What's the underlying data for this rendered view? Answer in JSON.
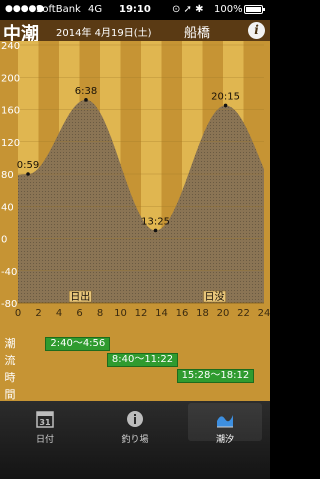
{
  "status_bar": {
    "signal": "●●●●●",
    "carrier": "SoftBank",
    "network": "4G",
    "time": "19:10",
    "icons": "⊙ ➚ ✱",
    "battery": "100%"
  },
  "header": {
    "tide_type": "中潮",
    "date": "2014年 4月19日(土)",
    "place": "船橋",
    "info_label": "i"
  },
  "chart_data": {
    "type": "area",
    "ylim": [
      -80,
      240
    ],
    "y_ticks": [
      "240",
      "200",
      "160",
      "120",
      "80",
      "40",
      "0",
      "-40",
      "-80"
    ],
    "x_ticks": [
      "0",
      "2",
      "4",
      "6",
      "8",
      "10",
      "12",
      "14",
      "16",
      "18",
      "20",
      "22",
      "24"
    ],
    "xlim": [
      0,
      24
    ],
    "extrema": [
      {
        "time": "0:59",
        "hour": 0.98,
        "level": 80
      },
      {
        "time": "6:38",
        "hour": 6.63,
        "level": 172
      },
      {
        "time": "13:25",
        "hour": 13.42,
        "level": 10
      },
      {
        "time": "20:15",
        "hour": 20.25,
        "level": 165
      }
    ],
    "sunrise_label": "日出",
    "sunrise_hour": 5.1,
    "sunset_label": "日没",
    "sunset_hour": 18.2,
    "colors": {
      "night": "#c69434",
      "day": "#e0b650",
      "curve_fill": "#7a6a52",
      "grid": "#a07828"
    }
  },
  "tidal_flow": {
    "header": [
      "潮",
      "流",
      "時",
      "間"
    ],
    "periods": [
      {
        "label": "2:40〜4:56",
        "start": 2.67,
        "end": 4.93
      },
      {
        "label": "8:40〜11:22",
        "start": 8.67,
        "end": 11.37
      },
      {
        "label": "15:28〜18:12",
        "start": 15.47,
        "end": 18.2
      }
    ]
  },
  "tabbar": {
    "tabs": [
      {
        "label": "日付",
        "icon": "calendar-icon",
        "day_num": "31"
      },
      {
        "label": "釣り場",
        "icon": "info-icon"
      },
      {
        "label": "潮汐",
        "icon": "tide-chart-icon"
      }
    ],
    "selected": 2
  }
}
